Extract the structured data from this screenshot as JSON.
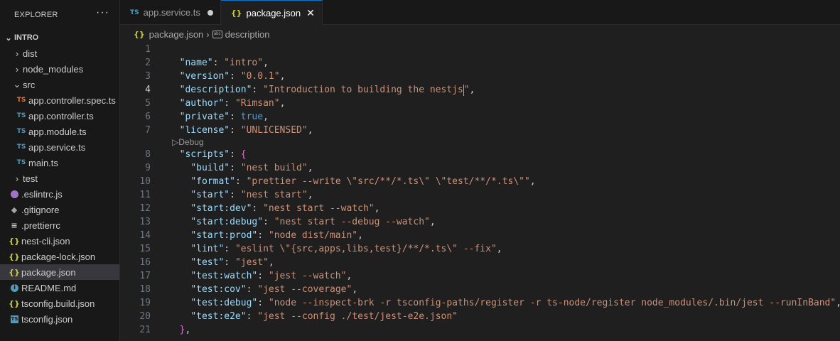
{
  "sidebar": {
    "title": "EXPLORER",
    "more": "···",
    "root": "INTRO",
    "items": [
      {
        "label": "dist",
        "type": "folder",
        "state": "collapsed",
        "depth": 1
      },
      {
        "label": "node_modules",
        "type": "folder",
        "state": "collapsed",
        "depth": 1
      },
      {
        "label": "src",
        "type": "folder",
        "state": "expanded",
        "depth": 1
      },
      {
        "label": "app.controller.spec.ts",
        "type": "tsspec",
        "depth": 2
      },
      {
        "label": "app.controller.ts",
        "type": "ts",
        "depth": 2
      },
      {
        "label": "app.module.ts",
        "type": "ts",
        "depth": 2
      },
      {
        "label": "app.service.ts",
        "type": "ts",
        "depth": 2
      },
      {
        "label": "main.ts",
        "type": "ts",
        "depth": 2
      },
      {
        "label": "test",
        "type": "folder",
        "state": "collapsed",
        "depth": 1
      },
      {
        "label": ".eslintrc.js",
        "type": "eslint",
        "depth": 1
      },
      {
        "label": ".gitignore",
        "type": "git",
        "depth": 1
      },
      {
        "label": ".prettierrc",
        "type": "prettier",
        "depth": 1
      },
      {
        "label": "nest-cli.json",
        "type": "json",
        "depth": 1
      },
      {
        "label": "package-lock.json",
        "type": "json",
        "depth": 1
      },
      {
        "label": "package.json",
        "type": "json",
        "depth": 1,
        "selected": true
      },
      {
        "label": "README.md",
        "type": "info",
        "depth": 1
      },
      {
        "label": "tsconfig.build.json",
        "type": "json",
        "depth": 1
      },
      {
        "label": "tsconfig.json",
        "type": "tsconfig",
        "depth": 1
      }
    ]
  },
  "tabs": [
    {
      "label": "app.service.ts",
      "icon": "TS",
      "modified": true,
      "active": false
    },
    {
      "label": "package.json",
      "icon": "{}",
      "modified": false,
      "active": true
    }
  ],
  "breadcrumb": {
    "file": "package.json",
    "symbol": "description"
  },
  "editor": {
    "codelens": "Debug",
    "current_line": 4,
    "lines": [
      {
        "n": "1",
        "tokens": []
      },
      {
        "n": "2",
        "tokens": [
          [
            "k",
            "\"name\""
          ],
          [
            "p",
            ": "
          ],
          [
            "s",
            "\"intro\""
          ],
          [
            "p",
            ","
          ]
        ],
        "indent": "  "
      },
      {
        "n": "3",
        "tokens": [
          [
            "k",
            "\"version\""
          ],
          [
            "p",
            ": "
          ],
          [
            "s",
            "\"0.0.1\""
          ],
          [
            "p",
            ","
          ]
        ],
        "indent": "  "
      },
      {
        "n": "4",
        "tokens": [
          [
            "k",
            "\"description\""
          ],
          [
            "p",
            ": "
          ],
          [
            "s",
            "\"Introduction to building the nestjs"
          ],
          [
            "cursor",
            ""
          ],
          [
            "s",
            "\""
          ],
          [
            "p",
            ","
          ]
        ],
        "indent": "  "
      },
      {
        "n": "5",
        "tokens": [
          [
            "k",
            "\"author\""
          ],
          [
            "p",
            ": "
          ],
          [
            "s",
            "\"Rimsan\""
          ],
          [
            "p",
            ","
          ]
        ],
        "indent": "  "
      },
      {
        "n": "6",
        "tokens": [
          [
            "k",
            "\"private\""
          ],
          [
            "p",
            ": "
          ],
          [
            "b",
            "true"
          ],
          [
            "p",
            ","
          ]
        ],
        "indent": "  "
      },
      {
        "n": "7",
        "tokens": [
          [
            "k",
            "\"license\""
          ],
          [
            "p",
            ": "
          ],
          [
            "s",
            "\"UNLICENSED\""
          ],
          [
            "p",
            ","
          ]
        ],
        "indent": "  ",
        "codelens_after": true
      },
      {
        "n": "8",
        "tokens": [
          [
            "k",
            "\"scripts\""
          ],
          [
            "p",
            ": "
          ],
          [
            "br",
            "{"
          ]
        ],
        "indent": "  "
      },
      {
        "n": "9",
        "tokens": [
          [
            "k",
            "\"build\""
          ],
          [
            "p",
            ": "
          ],
          [
            "s",
            "\"nest build\""
          ],
          [
            "p",
            ","
          ]
        ],
        "indent": "    "
      },
      {
        "n": "10",
        "tokens": [
          [
            "k",
            "\"format\""
          ],
          [
            "p",
            ": "
          ],
          [
            "s",
            "\"prettier --write \\\"src/**/*.ts\\\" \\\"test/**/*.ts\\\"\""
          ],
          [
            "p",
            ","
          ]
        ],
        "indent": "    "
      },
      {
        "n": "11",
        "tokens": [
          [
            "k",
            "\"start\""
          ],
          [
            "p",
            ": "
          ],
          [
            "s",
            "\"nest start\""
          ],
          [
            "p",
            ","
          ]
        ],
        "indent": "    "
      },
      {
        "n": "12",
        "tokens": [
          [
            "k",
            "\"start:dev\""
          ],
          [
            "p",
            ": "
          ],
          [
            "s",
            "\"nest start --watch\""
          ],
          [
            "p",
            ","
          ]
        ],
        "indent": "    "
      },
      {
        "n": "13",
        "tokens": [
          [
            "k",
            "\"start:debug\""
          ],
          [
            "p",
            ": "
          ],
          [
            "s",
            "\"nest start --debug --watch\""
          ],
          [
            "p",
            ","
          ]
        ],
        "indent": "    "
      },
      {
        "n": "14",
        "tokens": [
          [
            "k",
            "\"start:prod\""
          ],
          [
            "p",
            ": "
          ],
          [
            "s",
            "\"node dist/main\""
          ],
          [
            "p",
            ","
          ]
        ],
        "indent": "    "
      },
      {
        "n": "15",
        "tokens": [
          [
            "k",
            "\"lint\""
          ],
          [
            "p",
            ": "
          ],
          [
            "s",
            "\"eslint \\\"{src,apps,libs,test}/**/*.ts\\\" --fix\""
          ],
          [
            "p",
            ","
          ]
        ],
        "indent": "    "
      },
      {
        "n": "16",
        "tokens": [
          [
            "k",
            "\"test\""
          ],
          [
            "p",
            ": "
          ],
          [
            "s",
            "\"jest\""
          ],
          [
            "p",
            ","
          ]
        ],
        "indent": "    "
      },
      {
        "n": "17",
        "tokens": [
          [
            "k",
            "\"test:watch\""
          ],
          [
            "p",
            ": "
          ],
          [
            "s",
            "\"jest --watch\""
          ],
          [
            "p",
            ","
          ]
        ],
        "indent": "    "
      },
      {
        "n": "18",
        "tokens": [
          [
            "k",
            "\"test:cov\""
          ],
          [
            "p",
            ": "
          ],
          [
            "s",
            "\"jest --coverage\""
          ],
          [
            "p",
            ","
          ]
        ],
        "indent": "    "
      },
      {
        "n": "19",
        "tokens": [
          [
            "k",
            "\"test:debug\""
          ],
          [
            "p",
            ": "
          ],
          [
            "s",
            "\"node --inspect-brk -r tsconfig-paths/register -r ts-node/register node_modules/.bin/jest --runInBand\""
          ],
          [
            "p",
            ","
          ]
        ],
        "indent": "    "
      },
      {
        "n": "20",
        "tokens": [
          [
            "k",
            "\"test:e2e\""
          ],
          [
            "p",
            ": "
          ],
          [
            "s",
            "\"jest --config ./test/jest-e2e.json\""
          ]
        ],
        "indent": "    "
      },
      {
        "n": "21",
        "tokens": [
          [
            "br",
            "}"
          ],
          [
            "p",
            ","
          ]
        ],
        "indent": "  "
      }
    ]
  }
}
